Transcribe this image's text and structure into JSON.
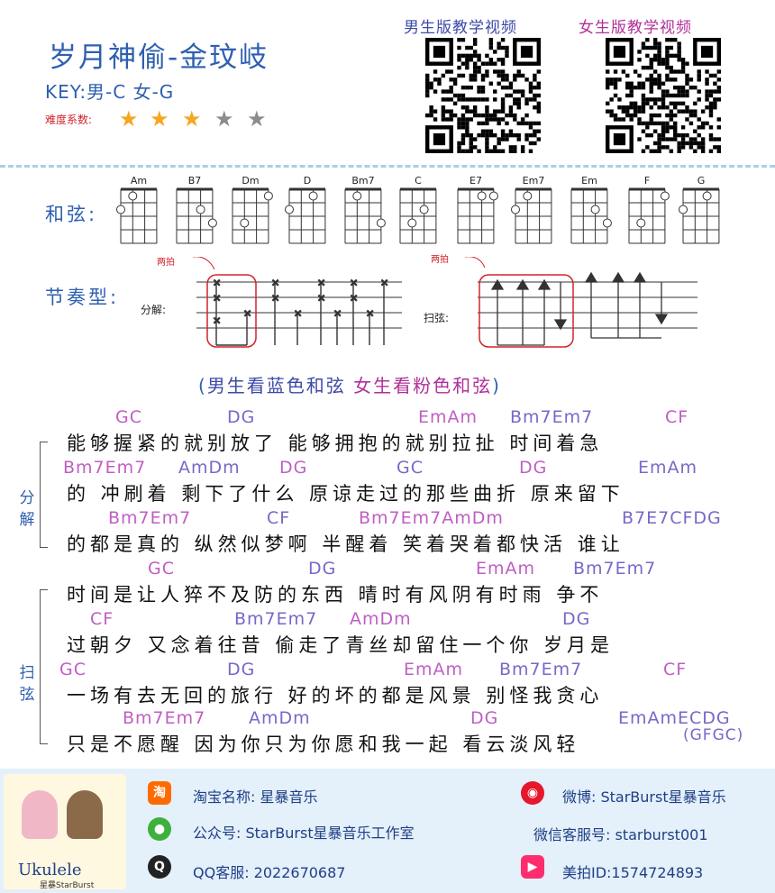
{
  "header": {
    "title": "岁月神偷-金玟岐",
    "key": "KEY:男-C   女-G",
    "difficulty_label": "难度系数:",
    "difficulty_rating": 3,
    "difficulty_max": 5,
    "qr_male_label": "男生版教学视频",
    "qr_female_label": "女生版教学视频"
  },
  "chords": {
    "label": "和弦:",
    "names": [
      "Am",
      "B7",
      "Dm",
      "D",
      "Bm7",
      "C",
      "E7",
      "Em7",
      "Em",
      "F",
      "G"
    ]
  },
  "rhythm": {
    "label": "节奏型:",
    "pick_label": "分解:",
    "strum_label": "扫弦:",
    "note1": "两拍",
    "note2": "两拍"
  },
  "instruction": {
    "prefix": "(",
    "male": "男生看蓝色和弦",
    "female": "女生看粉色和弦",
    "suffix": ")"
  },
  "lyrics": {
    "lines": [
      "能够握紧的就别放了  能够拥抱的就别拉扯  时间着急",
      "的 冲刷着 剩下了什么 原谅走过的那些曲折 原来留下",
      "的都是真的 纵然似梦啊 半醒着 笑着哭着都快活 谁让",
      "时间是让人猝不及防的东西  晴时有风阴有时雨  争不",
      "过朝夕 又念着往昔 偷走了青丝却留住一个你 岁月是",
      "一场有去无回的旅行 好的坏的都是风景  别怪我贪心",
      "只是不愿醒 因为你只为你愿和我一起 看云淡风轻"
    ],
    "chord_rows": [
      [
        "GC",
        "DG",
        "EmAm",
        "Bm7Em7",
        "CF"
      ],
      [
        "Bm7Em7",
        "AmDm",
        "DG",
        "GC",
        "DG",
        "EmAm"
      ],
      [
        "Bm7Em7",
        "CF",
        "Bm7Em7AmDm",
        "B7E7CFDG"
      ],
      [
        "GC",
        "DG",
        "EmAm",
        "Bm7Em7"
      ],
      [
        "CF",
        "Bm7Em7",
        "AmDm",
        "DG"
      ],
      [
        "GC",
        "DG",
        "EmAm",
        "Bm7Em7",
        "CF"
      ],
      [
        "Bm7Em7",
        "AmDm",
        "DG",
        "EmAmECDG"
      ]
    ],
    "ending": "(GFGC)",
    "side_pick": "分解",
    "side_strum": "扫弦"
  },
  "footer": {
    "taobao": "淘宝名称: 星暴音乐",
    "weibo": "微博: StarBurst星暴音乐",
    "wechat": "公众号: StarBurst星暴音乐工作室",
    "wechat_service": "微信客服号: starburst001",
    "qq": "QQ客服: 2022670687",
    "meipai": "美拍ID:1574724893",
    "logo_text": "Ukulele",
    "logo_sub": "星暴StarBurst"
  },
  "colors": {
    "title_blue": "#2e5fb0",
    "chord_pink": "#c05ec4",
    "chord_blue": "#7a67c8",
    "footer_bg": "#e4f0fa"
  }
}
